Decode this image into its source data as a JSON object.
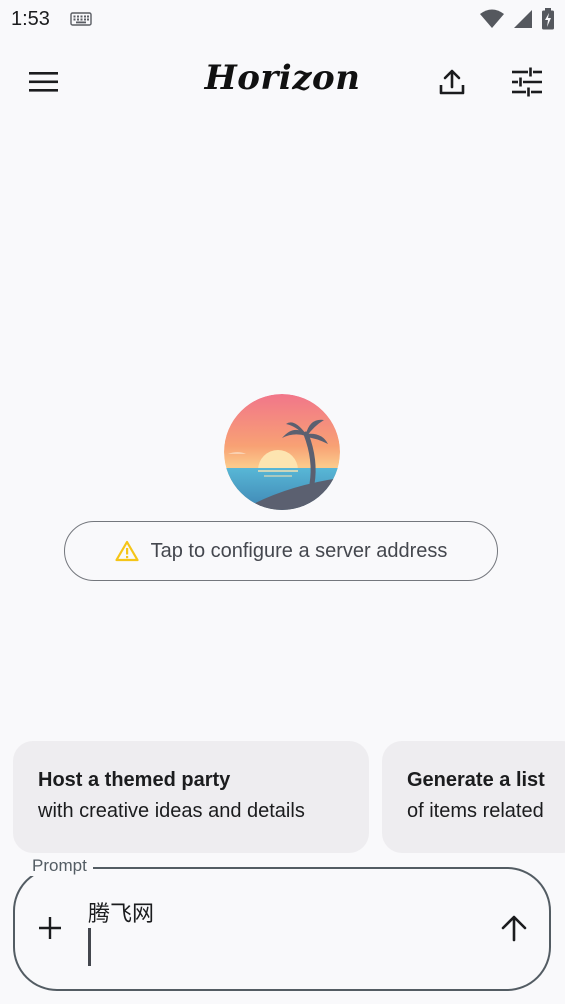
{
  "status_bar": {
    "time": "1:53",
    "icons": [
      "keyboard-icon",
      "wifi-icon",
      "signal-icon",
      "battery-icon"
    ]
  },
  "app_bar": {
    "title": "Horizon",
    "icons": [
      "menu-icon",
      "upload-icon",
      "tune-icon"
    ]
  },
  "server": {
    "label": "Tap to configure a server address",
    "icon": "warning-icon",
    "warning_color": "#f5c518"
  },
  "suggestions": [
    {
      "title": "Host a themed party",
      "subtitle": "with creative ideas and details"
    },
    {
      "title": "Generate a list",
      "subtitle": "of items related"
    }
  ],
  "prompt": {
    "label": "Prompt",
    "value": "腾飞网",
    "icons": [
      "add-icon",
      "send-icon"
    ]
  },
  "colors": {
    "background": "#f9f9fb",
    "card": "#eeedf0",
    "outline": "#74777d",
    "prompt_outline": "#535c63"
  }
}
